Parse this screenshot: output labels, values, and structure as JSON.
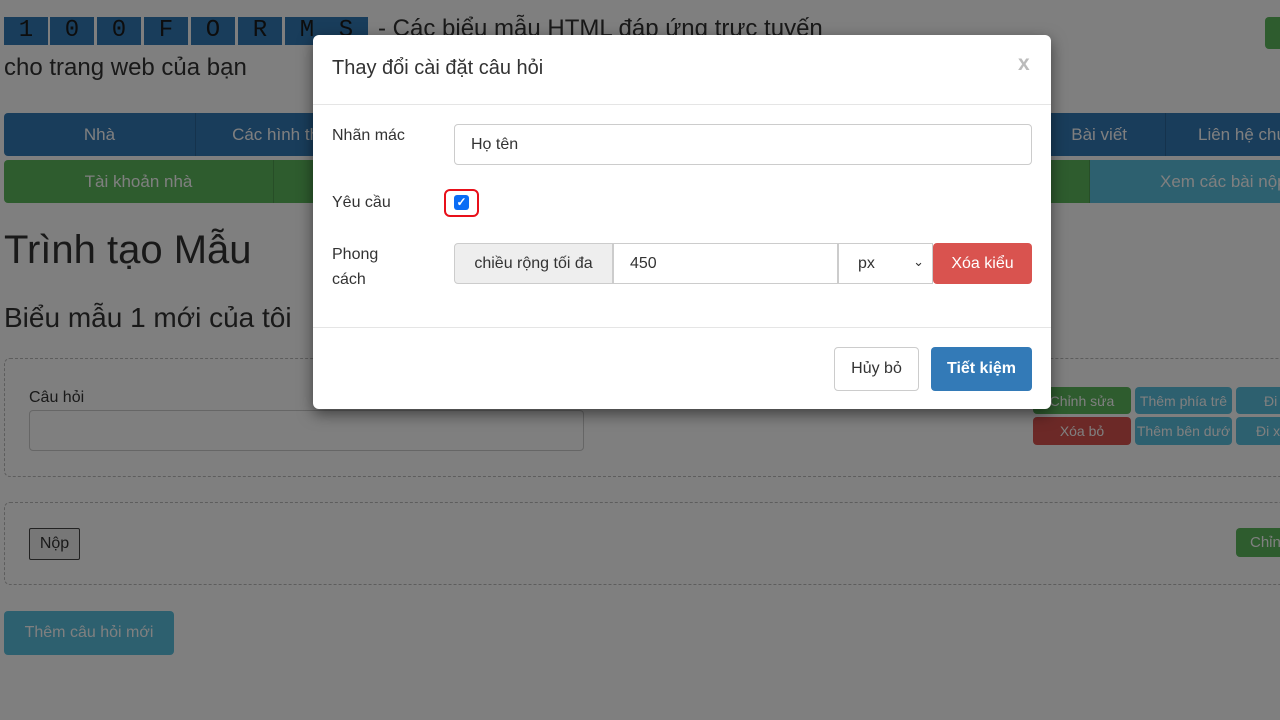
{
  "header": {
    "logo_letters": [
      "1",
      "0",
      "0",
      "F",
      "O",
      "R",
      "M",
      "S"
    ],
    "tagline": "- Các biểu mẫu HTML đáp ứng trực tuyến",
    "tagline_line2": "cho trang web của bạn"
  },
  "nav_primary": [
    "Nhà",
    "Các hình thức",
    "",
    "",
    "",
    "Bài viết",
    "Liên hệ chúng tôi"
  ],
  "nav_secondary": [
    "Tài khoản nhà",
    "",
    "",
    "Xem các bài nộp"
  ],
  "page": {
    "title": "Trình tạo Mẫu",
    "form_name": "Biểu mẫu 1 mới của tôi",
    "question_label": "Câu hỏi",
    "question_actions": {
      "edit": "Chỉnh sửa",
      "add_above": "Thêm phía trê",
      "move_up": "Đi",
      "delete": "Xóa bỏ",
      "add_below": "Thêm bên dướ",
      "move_down": "Đi x"
    },
    "submit_label": "Nộp",
    "submit_edit": "Chỉn",
    "add_question": "Thêm câu hỏi mới"
  },
  "modal": {
    "title": "Thay đổi cài đặt câu hỏi",
    "close": "x",
    "label_field": {
      "label": "Nhãn mác",
      "value": "Họ tên"
    },
    "required": {
      "label": "Yêu cầu",
      "checked": true
    },
    "style": {
      "label_line1": "Phong",
      "label_line2": "cách",
      "addon": "chiều rộng tối đa",
      "value": "450",
      "unit": "px",
      "clear": "Xóa kiểu"
    },
    "cancel": "Hủy bỏ",
    "save": "Tiết kiệm"
  },
  "colors": {
    "primary": "#337ab7",
    "success": "#5cb85c",
    "info": "#5bc0de",
    "danger": "#d9534f",
    "highlight": "#e8101a"
  }
}
